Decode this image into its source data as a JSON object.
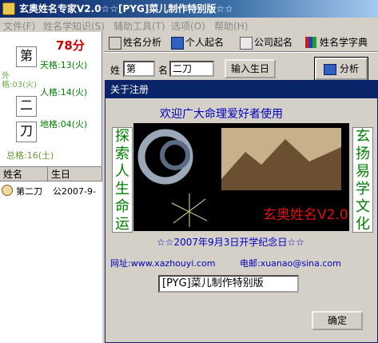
{
  "window": {
    "title": "玄奥姓名专家V2.0☆☆[PYG]菜儿制作特别版☆☆"
  },
  "menu": {
    "items": [
      "文件(F)",
      "姓名学知识(S)",
      "辅助工具(T)",
      "选项(O)",
      "帮助(H)"
    ]
  },
  "left": {
    "chars": [
      "第",
      "二",
      "刀"
    ],
    "score": "78分",
    "tiange": "天格:13(火)",
    "renge": "人格:14(火)",
    "dige": "地格:04(火)",
    "zongge": "总格:16(土)",
    "wuxing": "外格:03(火)"
  },
  "table": {
    "headers": [
      "姓名",
      "生日"
    ],
    "rows": [
      {
        "name": "第二刀",
        "birthday": "公2007-9-"
      }
    ]
  },
  "tabs": [
    "姓名分析",
    "个人起名",
    "公司起名",
    "姓名学字典"
  ],
  "form": {
    "surname_label": "姓",
    "surname_value": "第",
    "given_label": "名",
    "given_value": "二刀",
    "birth_button": "输入生日",
    "analyze_button": "分析"
  },
  "dialog": {
    "title": "关于注册",
    "welcome": "欢迎广大命理爱好者使用",
    "left_vertical": "探索人生命运",
    "right_vertical": "玄扬易学文化",
    "art_title": "玄奥姓名V2.0",
    "anniversary": "☆☆2007年9月3日开学纪念日☆☆",
    "url_label": "网址:www.xazhouyi.com",
    "mail_label": "电邮:xuanao@sina.com",
    "reg_value": "[PYG]菜儿制作特别版",
    "ok_button": "确定"
  },
  "colors": {
    "titlebar": "#0a246a",
    "score": "#d00000",
    "ge_text": "#008000",
    "dialog_text": "#0000c0"
  }
}
